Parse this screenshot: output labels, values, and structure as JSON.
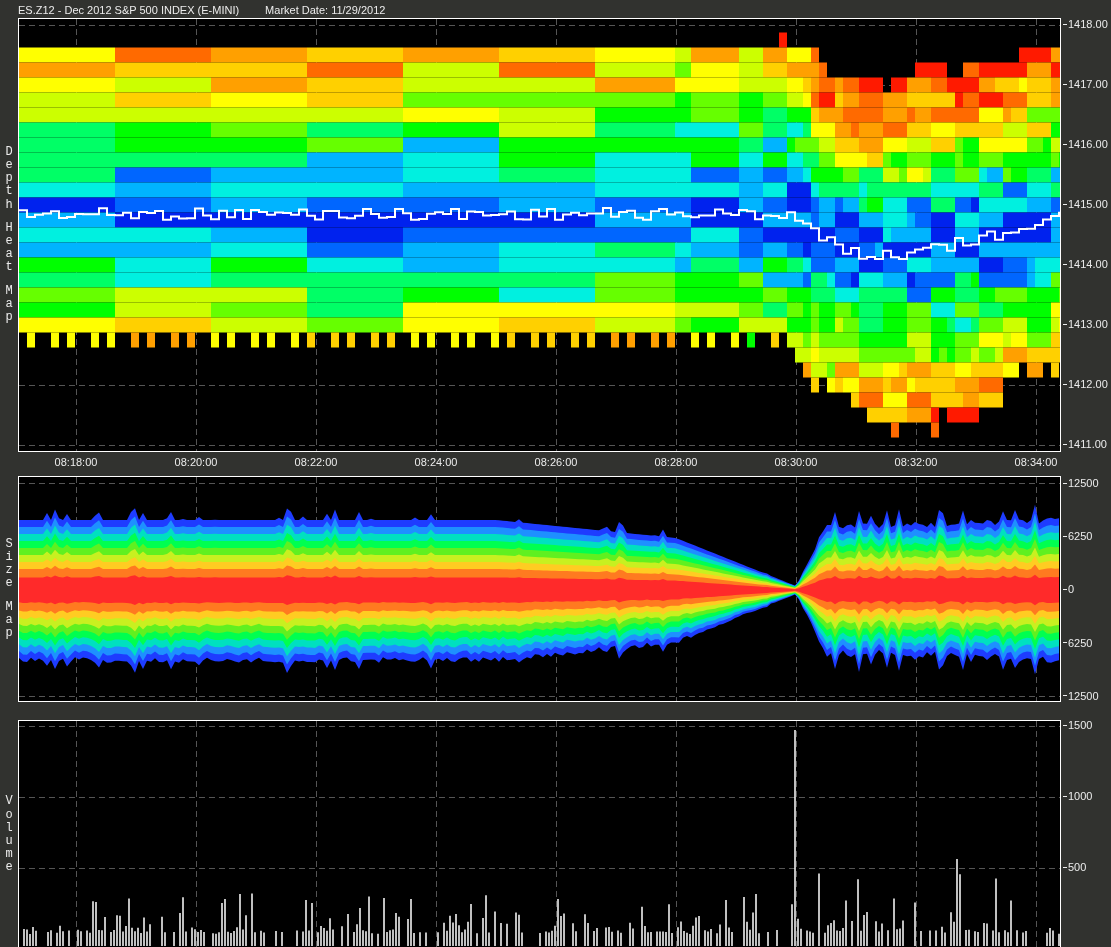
{
  "header": {
    "title": "ES.Z12 - Dec 2012 S&P 500 INDEX (E-MINI)",
    "market_date": "Market Date: 11/29/2012"
  },
  "depth_heat_map": {
    "axis_title": [
      "Depth",
      "Heat",
      "Map"
    ],
    "price_ticks": [
      "1418.00",
      "1417.00",
      "1416.00",
      "1415.00",
      "1414.00",
      "1413.00",
      "1412.00",
      "1411.00"
    ]
  },
  "time_axis": {
    "ticks": [
      "08:18:00",
      "08:20:00",
      "08:22:00",
      "08:24:00",
      "08:26:00",
      "08:28:00",
      "08:30:00",
      "08:32:00",
      "08:34:00"
    ]
  },
  "size_map": {
    "axis_title": [
      "Size",
      "Map"
    ],
    "ticks": [
      "12500",
      "6250",
      "0",
      "6250",
      "12500"
    ]
  },
  "volume": {
    "axis_title": [
      "Volume"
    ],
    "ticks": [
      "1500",
      "1000",
      "500"
    ]
  }
}
